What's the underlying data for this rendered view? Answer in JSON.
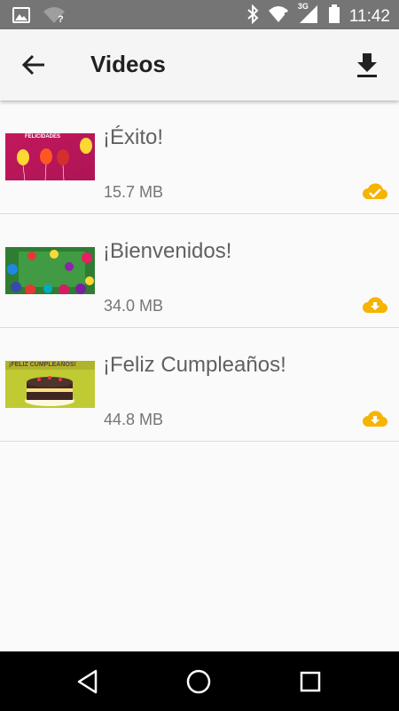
{
  "status_bar": {
    "time": "11:42",
    "network_label": "3G",
    "icons": [
      "image-icon",
      "wifi-unknown-icon",
      "bluetooth-icon",
      "wifi-alert-icon",
      "cellular-signal-icon",
      "battery-icon"
    ]
  },
  "toolbar": {
    "title": "Videos",
    "back_icon": "arrow-left-icon",
    "download_icon": "download-icon"
  },
  "videos": [
    {
      "name": "¡Éxito!",
      "size": "15.7 MB",
      "status": "downloaded",
      "status_icon": "cloud-done-icon",
      "thumb_text": "FELICIDADES"
    },
    {
      "name": "¡Bienvenidos!",
      "size": "34.0 MB",
      "status": "not-downloaded",
      "status_icon": "cloud-download-icon",
      "thumb_text": ""
    },
    {
      "name": "¡Feliz Cumpleaños!",
      "size": "44.8 MB",
      "status": "not-downloaded",
      "status_icon": "cloud-download-icon",
      "thumb_text": "¡FELIZ CUMPLEAÑOS!"
    }
  ],
  "colors": {
    "accent": "#f5b400",
    "status_bar": "#757575",
    "toolbar": "#f5f5f5",
    "nav_bar": "#000000"
  },
  "nav_bar": {
    "icons": [
      "back-triangle-icon",
      "home-circle-icon",
      "recents-square-icon"
    ]
  }
}
